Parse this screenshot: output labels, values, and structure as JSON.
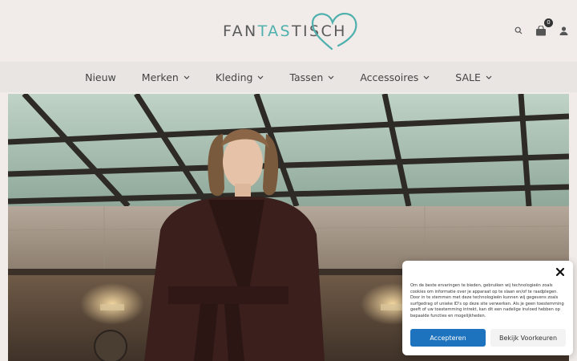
{
  "header": {
    "logo": {
      "part1": "FAN",
      "part2": "TAS",
      "part3": "TISCH"
    },
    "icons": [
      "search-icon",
      "cart-icon",
      "user-icon"
    ],
    "cart_count": "0",
    "accent_color": "#4fb0ad"
  },
  "nav": {
    "items": [
      {
        "label": "Nieuw",
        "has_dropdown": false
      },
      {
        "label": "Merken",
        "has_dropdown": true
      },
      {
        "label": "Kleding",
        "has_dropdown": true
      },
      {
        "label": "Tassen",
        "has_dropdown": true
      },
      {
        "label": "Accessoires",
        "has_dropdown": true
      },
      {
        "label": "SALE",
        "has_dropdown": true
      }
    ]
  },
  "cookie": {
    "text": "Om de beste ervaringen te bieden, gebruiken wij technologieën zoals cookies om informatie over je apparaat op te slaan en/of te raadplegen. Door in te stemmen met deze technologieën kunnen wij gegevens zoals surfgedrag of unieke ID's op deze site verwerken. Als je geen toestemming geeft of uw toestemming intrekt, kan dit een nadelige invloed hebben op bepaalde functies en mogelijkheden.",
    "accept_label": "Accepteren",
    "prefs_label": "Bekijk Voorkeuren",
    "accept_color": "#1e73be"
  }
}
